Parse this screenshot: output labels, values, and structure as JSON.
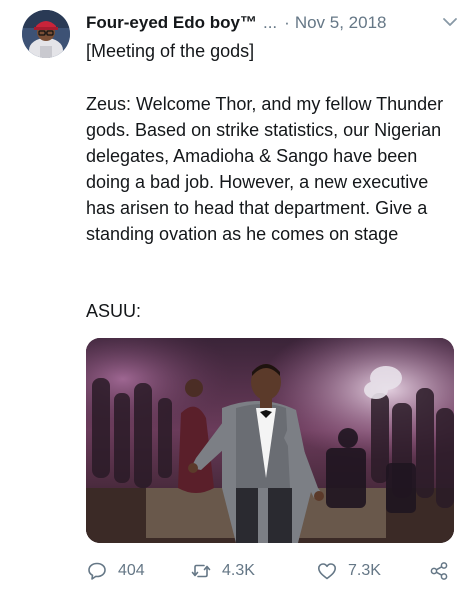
{
  "tweet": {
    "author_name": "Four-eyed Edo boy™",
    "handle_ellipsis": "...",
    "separator": "·",
    "date": "Nov 5, 2018",
    "subtitle": "[Meeting of the gods]",
    "body": "Zeus: Welcome Thor, and my fellow Thunder gods. Based on strike statistics, our Nigerian delegates, Amadioha & Sango have been doing a bad job. However, a new executive has arisen to head that department. Give a standing ovation as he comes on stage",
    "closing": "ASUU:",
    "icons": {
      "menu": "chevron-down-icon",
      "reply": "reply-icon",
      "retweet": "retweet-icon",
      "like": "heart-icon",
      "share": "share-icon"
    }
  },
  "stats": {
    "replies": "404",
    "retweets": "4.3K",
    "likes": "7.3K"
  },
  "colors": {
    "text": "#14171a",
    "muted": "#657786"
  }
}
